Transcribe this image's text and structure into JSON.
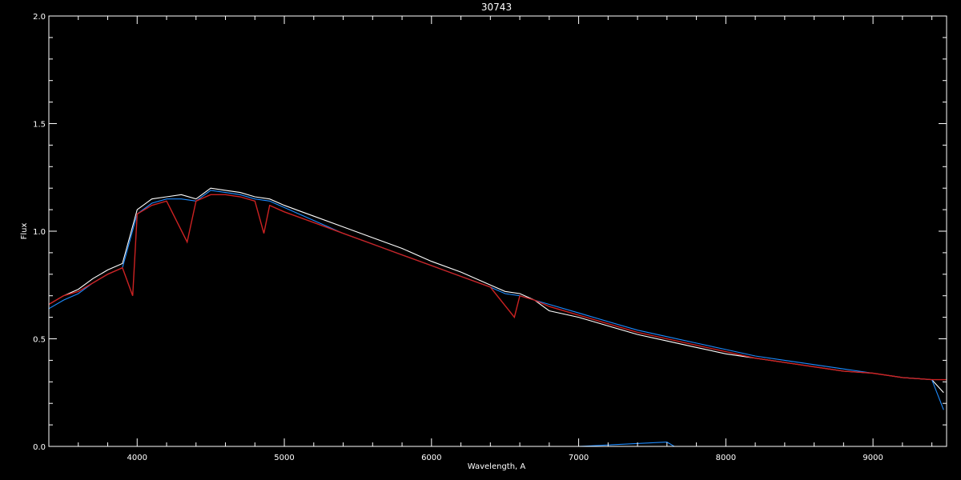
{
  "chart_data": {
    "type": "line",
    "title": "30743",
    "xlabel": "Wavelength, A",
    "ylabel": "Flux",
    "xlim": [
      3400,
      9500
    ],
    "ylim": [
      0.0,
      2.0
    ],
    "x_ticks": [
      4000,
      5000,
      6000,
      7000,
      8000,
      9000
    ],
    "x_tick_labels": [
      "4000",
      "5000",
      "6000",
      "7000",
      "8000",
      "9000"
    ],
    "y_ticks": [
      0.0,
      0.5,
      1.0,
      1.5,
      2.0
    ],
    "y_tick_labels": [
      "0.0",
      "0.5",
      "1.0",
      "1.5",
      "2.0"
    ],
    "grid": false,
    "background": "#000000",
    "series": [
      {
        "color": "#ffffff",
        "x": [
          3400,
          3500,
          3600,
          3700,
          3800,
          3900,
          4000,
          4100,
          4200,
          4300,
          4400,
          4500,
          4600,
          4700,
          4800,
          4900,
          5000,
          5200,
          5400,
          5600,
          5800,
          6000,
          6200,
          6400,
          6500,
          6600,
          6700,
          6800,
          7000,
          7200,
          7400,
          7600,
          7800,
          8000,
          8200,
          8400,
          8600,
          8800,
          9000,
          9200,
          9400,
          9480
        ],
        "y": [
          0.66,
          0.7,
          0.73,
          0.78,
          0.82,
          0.85,
          1.1,
          1.15,
          1.16,
          1.17,
          1.15,
          1.2,
          1.19,
          1.18,
          1.16,
          1.15,
          1.12,
          1.07,
          1.02,
          0.97,
          0.92,
          0.86,
          0.81,
          0.75,
          0.72,
          0.71,
          0.68,
          0.63,
          0.6,
          0.56,
          0.52,
          0.49,
          0.46,
          0.43,
          0.41,
          0.39,
          0.37,
          0.35,
          0.34,
          0.32,
          0.31,
          0.25
        ]
      },
      {
        "color": "#1e8cff",
        "x": [
          3400,
          3500,
          3600,
          3700,
          3800,
          3900,
          4000,
          4100,
          4200,
          4300,
          4400,
          4500,
          4600,
          4700,
          4800,
          4900,
          5000,
          5200,
          5400,
          5600,
          5800,
          6000,
          6200,
          6400,
          6500,
          6600,
          6700,
          6800,
          7000,
          7200,
          7400,
          7600,
          7800,
          8000,
          8200,
          8400,
          8600,
          8800,
          9000,
          9200,
          9400,
          9480
        ],
        "y": [
          0.64,
          0.68,
          0.71,
          0.76,
          0.8,
          0.83,
          1.08,
          1.13,
          1.15,
          1.15,
          1.14,
          1.19,
          1.18,
          1.17,
          1.15,
          1.14,
          1.11,
          1.05,
          0.99,
          0.94,
          0.89,
          0.84,
          0.79,
          0.74,
          0.71,
          0.7,
          0.68,
          0.66,
          0.62,
          0.58,
          0.54,
          0.51,
          0.48,
          0.45,
          0.42,
          0.4,
          0.38,
          0.36,
          0.34,
          0.32,
          0.31,
          0.17
        ]
      },
      {
        "color": "#cc2222",
        "x": [
          3400,
          3500,
          3600,
          3700,
          3800,
          3900,
          3970,
          4000,
          4100,
          4200,
          4340,
          4400,
          4500,
          4600,
          4700,
          4800,
          4861,
          4900,
          5000,
          5200,
          5400,
          5600,
          5800,
          6000,
          6200,
          6400,
          6563,
          6600,
          6700,
          6800,
          7000,
          7200,
          7400,
          7600,
          7800,
          8000,
          8200,
          8400,
          8600,
          8800,
          9000,
          9200,
          9400,
          9500
        ],
        "y": [
          0.66,
          0.7,
          0.72,
          0.76,
          0.8,
          0.83,
          0.7,
          1.08,
          1.12,
          1.14,
          0.95,
          1.14,
          1.17,
          1.17,
          1.16,
          1.14,
          0.99,
          1.12,
          1.09,
          1.04,
          0.99,
          0.94,
          0.89,
          0.84,
          0.79,
          0.74,
          0.6,
          0.7,
          0.68,
          0.65,
          0.61,
          0.57,
          0.53,
          0.5,
          0.47,
          0.44,
          0.41,
          0.39,
          0.37,
          0.35,
          0.34,
          0.32,
          0.31,
          0.31
        ]
      },
      {
        "color": "#1e8cff",
        "x": [
          3400,
          5000,
          7000,
          7600,
          7650,
          8000,
          9500
        ],
        "y": [
          0.0,
          0.0,
          0.0,
          0.02,
          0.0,
          0.0,
          0.0
        ]
      }
    ]
  }
}
